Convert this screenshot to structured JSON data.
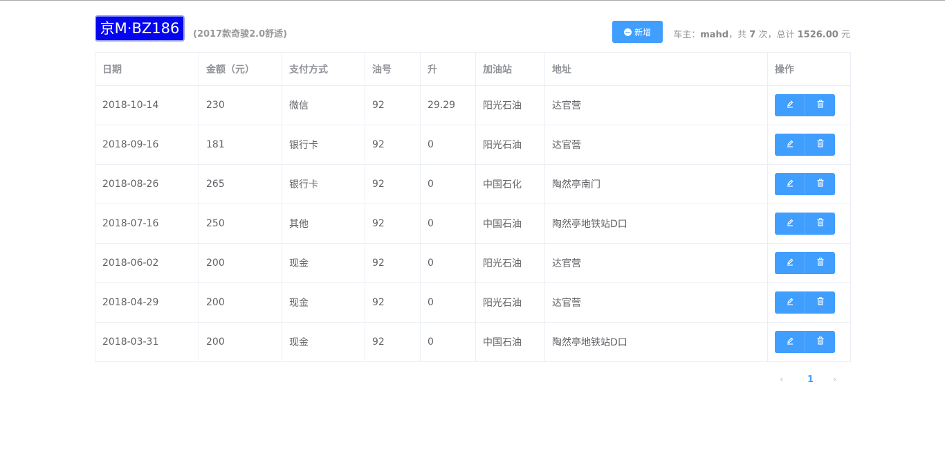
{
  "car": {
    "plate": "京M·BZ186",
    "model": "(2017款奇骏2.0舒适)"
  },
  "toolbar": {
    "add_label": "新增"
  },
  "summary": {
    "owner_prefix": "车主：",
    "owner": "mahd",
    "count_prefix": "，共",
    "count": "7",
    "count_suffix": "次，总计",
    "total": "1526.00",
    "total_suffix": "元"
  },
  "table": {
    "headers": [
      "日期",
      "金额（元）",
      "支付方式",
      "油号",
      "升",
      "加油站",
      "地址",
      "操作"
    ],
    "rows": [
      [
        "2018-10-14",
        "230",
        "微信",
        "92",
        "29.29",
        "阳光石油",
        "达官营"
      ],
      [
        "2018-09-16",
        "181",
        "银行卡",
        "92",
        "0",
        "阳光石油",
        "达官营"
      ],
      [
        "2018-08-26",
        "265",
        "银行卡",
        "92",
        "0",
        "中国石化",
        "陶然亭南门"
      ],
      [
        "2018-07-16",
        "250",
        "其他",
        "92",
        "0",
        "中国石油",
        "陶然亭地铁站D口"
      ],
      [
        "2018-06-02",
        "200",
        "现金",
        "92",
        "0",
        "阳光石油",
        "达官营"
      ],
      [
        "2018-04-29",
        "200",
        "现金",
        "92",
        "0",
        "阳光石油",
        "达官营"
      ],
      [
        "2018-03-31",
        "200",
        "现金",
        "92",
        "0",
        "中国石油",
        "陶然亭地铁站D口"
      ]
    ]
  },
  "pager": {
    "prev": "‹",
    "current": "1",
    "next": "›"
  },
  "colors": {
    "primary": "#409eff",
    "plate": "#0505ee"
  },
  "icons": [
    "plus-circle-icon",
    "edit-icon",
    "delete-icon",
    "chevron-left-icon",
    "chevron-right-icon"
  ]
}
